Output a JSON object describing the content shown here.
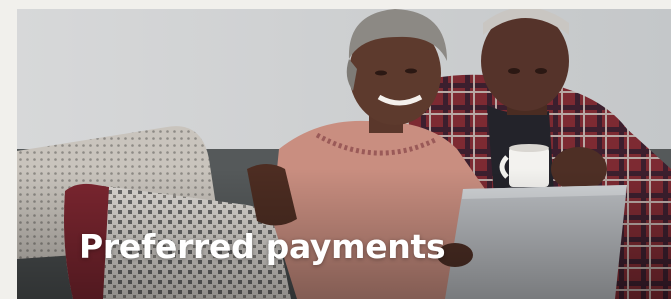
{
  "hero": {
    "title": "Preferred payments",
    "image_description_icon": "couple-on-sofa-with-laptop-photo"
  },
  "colors": {
    "page_background": "#f1f0ec",
    "title_text": "#ffffff",
    "wall": "#cfd1d3",
    "sofa": "#55595a",
    "blouse": "#c98e80",
    "flannel": "#8a2e35",
    "laptop": "#b9bcc0"
  }
}
